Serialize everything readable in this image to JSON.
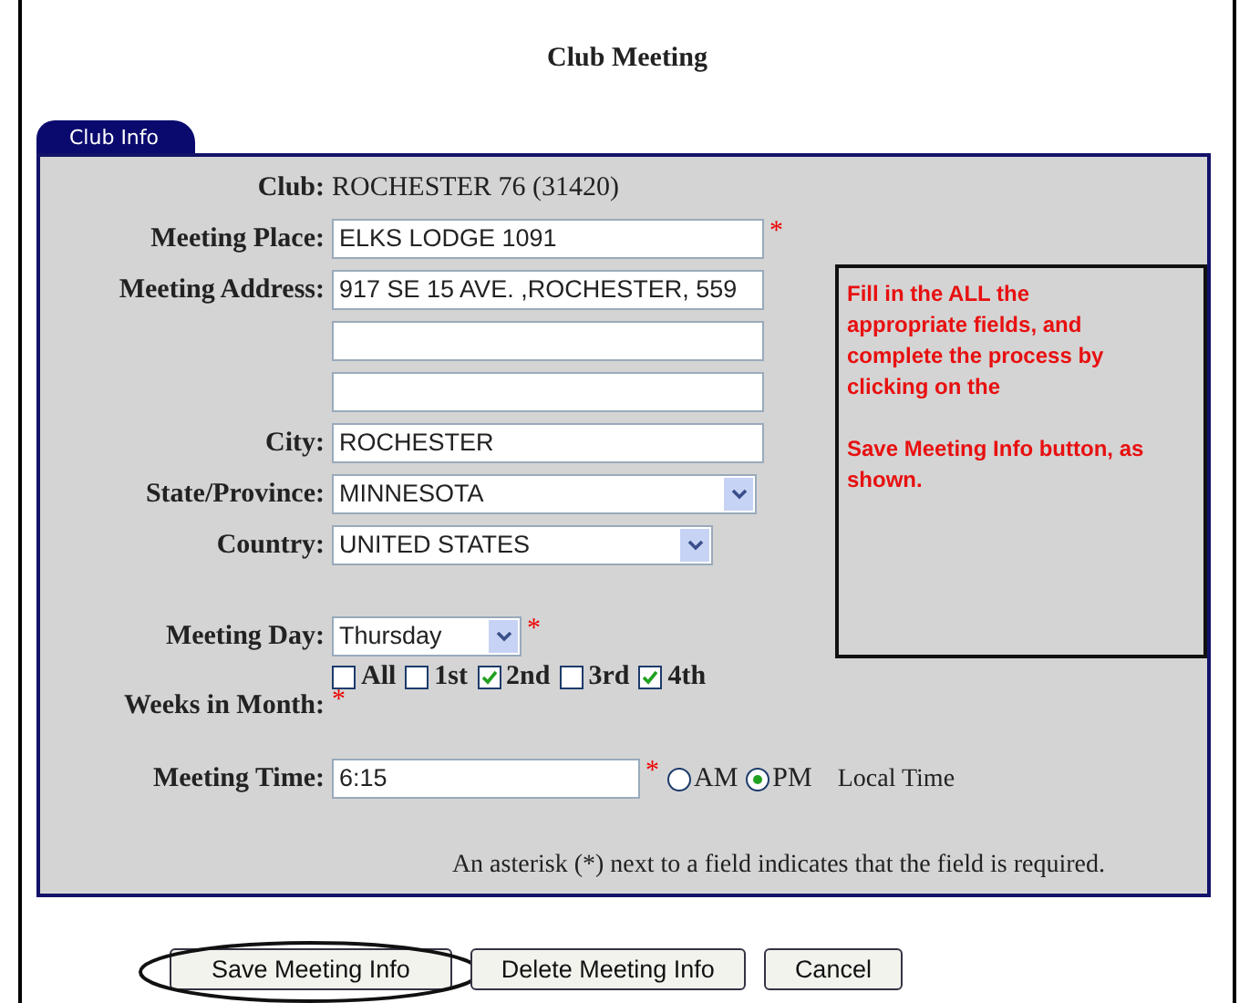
{
  "title": "Club Meeting",
  "tab": {
    "label": "Club Info",
    "selected": true
  },
  "fields": [
    {
      "kind": "static",
      "label": "Club:",
      "value": "ROCHESTER 76 (31420)"
    },
    {
      "kind": "text",
      "label": "Meeting Place:",
      "value": "ELKS LODGE 1091",
      "asterisk": "*"
    },
    {
      "kind": "text",
      "label": "Meeting Address:",
      "value": "917 SE 15 AVE. ,ROCHESTER, 559"
    },
    {
      "kind": "text"
    },
    {
      "kind": "text"
    },
    {
      "kind": "text",
      "label": "City:",
      "value": "ROCHESTER"
    },
    {
      "kind": "select",
      "label": "State/Province:",
      "value": "MINNESOTA"
    },
    {
      "kind": "select",
      "label": "Country:",
      "value": "UNITED STATES"
    }
  ],
  "note": [
    "Fill in the ALL the appropriate fields, and complete the process by clicking on the",
    "Save Meeting Info button, as shown."
  ],
  "meeting_day": {
    "label": "Meeting Day:",
    "value": "Thursday",
    "asterisk": "*"
  },
  "weeks": {
    "label": "Weeks in Month:",
    "asterisk": "*",
    "options": [
      {
        "label": "All",
        "checked": false
      },
      {
        "label": "1st",
        "checked": false
      },
      {
        "label": "2nd",
        "checked": true
      },
      {
        "label": "3rd",
        "checked": false
      },
      {
        "label": "4th",
        "checked": true
      }
    ]
  },
  "meeting_time": {
    "label": "Meeting Time:",
    "value": "6:15",
    "asterisk": "*",
    "periods": [
      {
        "label": "AM",
        "selected": false
      },
      {
        "label": "PM",
        "selected": true
      }
    ],
    "suffix": "Local Time"
  },
  "footnote": "An asterisk (*) next to a field indicates that the field is required.",
  "buttons": [
    {
      "label": "Save Meeting Info",
      "highlighted": true
    },
    {
      "label": "Delete Meeting Info",
      "highlighted": false
    },
    {
      "label": "Cancel",
      "highlighted": false
    }
  ]
}
